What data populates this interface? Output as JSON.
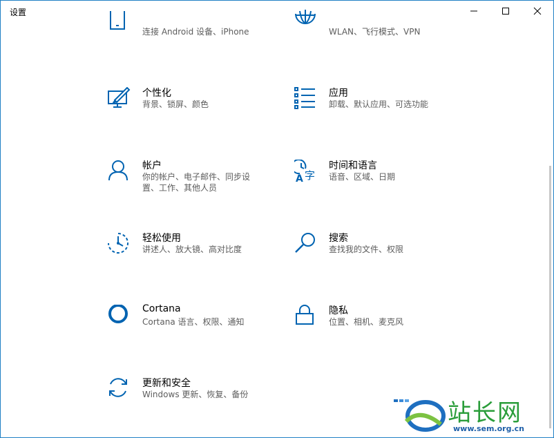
{
  "window": {
    "title": "设置"
  },
  "tiles": [
    {
      "title": "",
      "subtitle": "连接 Android 设备、iPhone",
      "icon": "phone-icon"
    },
    {
      "title": "",
      "subtitle": "WLAN、飞行模式、VPN",
      "icon": "globe-icon"
    },
    {
      "title": "个性化",
      "subtitle": "背景、锁屏、颜色",
      "icon": "personalization-icon"
    },
    {
      "title": "应用",
      "subtitle": "卸载、默认应用、可选功能",
      "icon": "apps-list-icon"
    },
    {
      "title": "帐户",
      "subtitle": "你的帐户、电子邮件、同步设置、工作、其他人员",
      "icon": "user-icon"
    },
    {
      "title": "时间和语言",
      "subtitle": "语音、区域、日期",
      "icon": "time-language-icon"
    },
    {
      "title": "轻松使用",
      "subtitle": "讲述人、放大镜、高对比度",
      "icon": "ease-of-access-icon"
    },
    {
      "title": "搜索",
      "subtitle": "查找我的文件、权限",
      "icon": "search-icon"
    },
    {
      "title": "Cortana",
      "subtitle": "Cortana 语言、权限、通知",
      "icon": "cortana-icon"
    },
    {
      "title": "隐私",
      "subtitle": "位置、相机、麦克风",
      "icon": "lock-icon"
    },
    {
      "title": "更新和安全",
      "subtitle": "Windows 更新、恢复、备份",
      "icon": "update-icon"
    }
  ],
  "watermark": {
    "brand": "站长网",
    "url": "www.sem.org.cn"
  },
  "colors": {
    "accent": "#0063b1",
    "border": "#1e7fc4",
    "subtitle": "#5c5c5c"
  }
}
